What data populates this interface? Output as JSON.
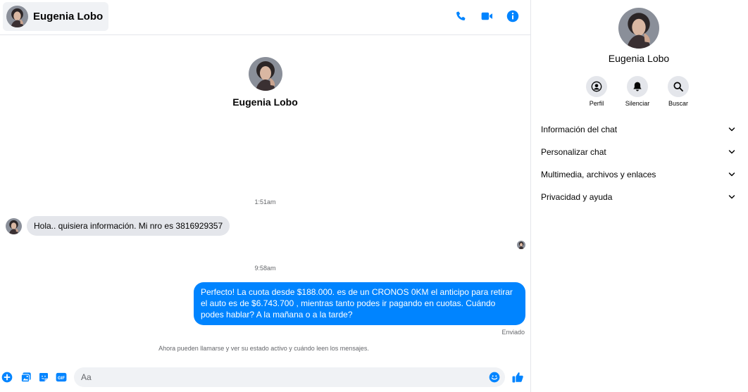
{
  "contact": {
    "name": "Eugenia Lobo"
  },
  "header": {
    "actions": [
      {
        "name": "call-icon"
      },
      {
        "name": "video-call-icon"
      },
      {
        "name": "info-icon"
      }
    ]
  },
  "conversation": {
    "intro_name": "Eugenia Lobo",
    "timestamp_1": "1:51am",
    "incoming_message": "Hola.. quisiera información. Mi nro es 3816929357",
    "timestamp_2": "9:58am",
    "outgoing_message": "Perfecto! La cuota desde $188.000. es de un CRONOS 0KM el anticipo para retirar el auto es de $6.743.700 , mientras tanto podes ir pagando en cuotas. Cuándo podes hablar? A la mañana o a la tarde?",
    "sent_status": "Enviado",
    "system_note": "Ahora pueden llamarse y ver su estado activo y cuándo leen los mensajes."
  },
  "composer": {
    "placeholder": "Aa",
    "tools": [
      "add-icon",
      "photo-icon",
      "sticker-icon",
      "gif-icon"
    ],
    "gif_label": "GIF"
  },
  "info_panel": {
    "name": "Eugenia Lobo",
    "actions": [
      {
        "label": "Perfil",
        "icon": "profile-icon"
      },
      {
        "label": "Silenciar",
        "icon": "bell-icon"
      },
      {
        "label": "Buscar",
        "icon": "search-icon"
      }
    ],
    "sections": [
      {
        "label": "Información del chat"
      },
      {
        "label": "Personalizar chat"
      },
      {
        "label": "Multimedia, archivos y enlaces"
      },
      {
        "label": "Privacidad y ayuda"
      }
    ]
  },
  "colors": {
    "accent": "#0084ff",
    "incoming_bubble": "#e4e6eb",
    "secondary_text": "#65676b"
  }
}
